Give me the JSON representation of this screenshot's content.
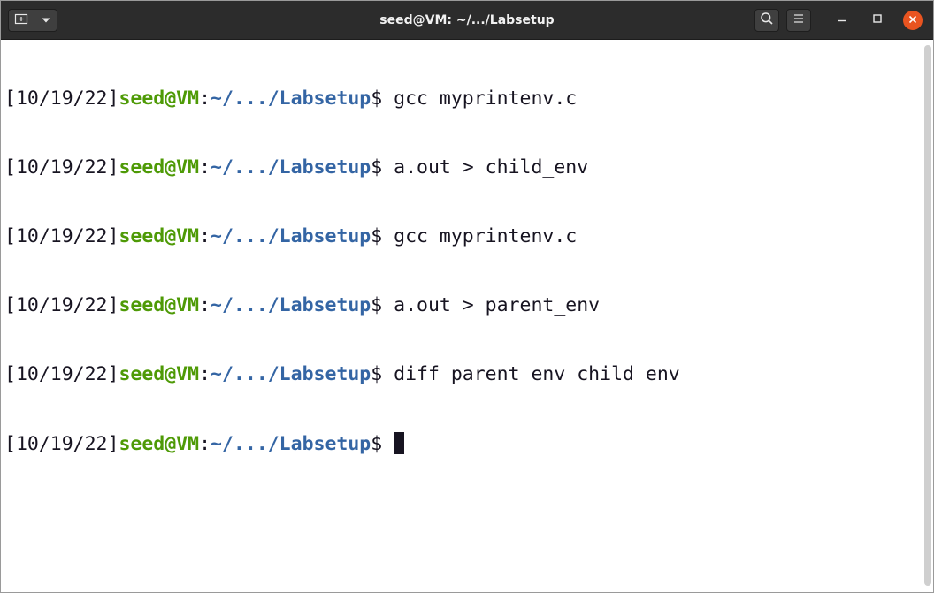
{
  "window": {
    "title": "seed@VM: ~/.../Labsetup"
  },
  "icons": {
    "new_tab": "new-tab-icon",
    "tab_menu": "chevron-down-icon",
    "search": "search-icon",
    "menu": "hamburger-menu-icon",
    "minimize": "minimize-icon",
    "maximize": "maximize-icon",
    "close": "close-icon"
  },
  "colors": {
    "user_host": "#4e9a06",
    "path": "#3465a4",
    "close_button": "#e95420"
  },
  "terminal": {
    "lines": [
      {
        "date": "[10/19/22]",
        "user": "seed@VM",
        "colon": ":",
        "path": "~/.../Labsetup",
        "dollar": "$",
        "command": " gcc myprintenv.c"
      },
      {
        "date": "[10/19/22]",
        "user": "seed@VM",
        "colon": ":",
        "path": "~/.../Labsetup",
        "dollar": "$",
        "command": " a.out > child_env"
      },
      {
        "date": "[10/19/22]",
        "user": "seed@VM",
        "colon": ":",
        "path": "~/.../Labsetup",
        "dollar": "$",
        "command": " gcc myprintenv.c"
      },
      {
        "date": "[10/19/22]",
        "user": "seed@VM",
        "colon": ":",
        "path": "~/.../Labsetup",
        "dollar": "$",
        "command": " a.out > parent_env"
      },
      {
        "date": "[10/19/22]",
        "user": "seed@VM",
        "colon": ":",
        "path": "~/.../Labsetup",
        "dollar": "$",
        "command": " diff parent_env child_env"
      },
      {
        "date": "[10/19/22]",
        "user": "seed@VM",
        "colon": ":",
        "path": "~/.../Labsetup",
        "dollar": "$",
        "command": " "
      }
    ]
  }
}
